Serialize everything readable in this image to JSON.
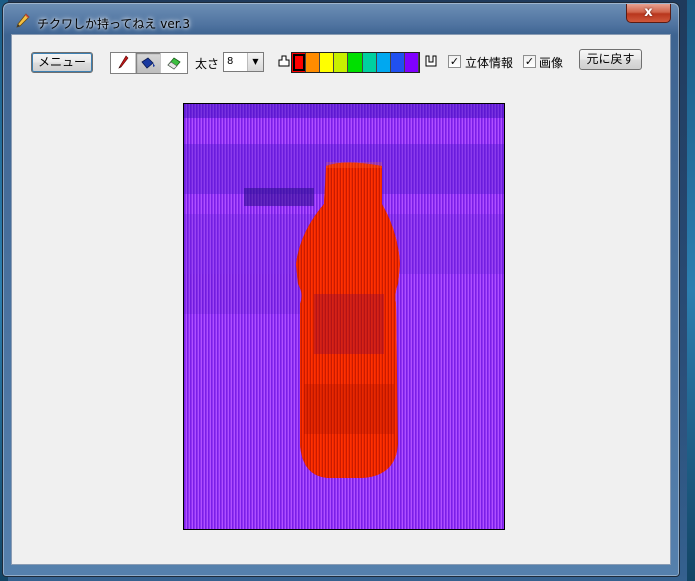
{
  "window": {
    "title": "チクワしか持ってねえ ver.3",
    "close_label": "x"
  },
  "toolbar": {
    "menu_label": "メニュー",
    "tools": [
      {
        "name": "pen",
        "icon": "pen-icon"
      },
      {
        "name": "fill",
        "icon": "paint-bucket-icon"
      },
      {
        "name": "eraser",
        "icon": "eraser-icon"
      }
    ],
    "active_tool": "fill",
    "size_label": "太さ",
    "size_value": "8",
    "convex_label": "凸",
    "concave_label": "凹",
    "palette": [
      "#ff0000",
      "#ff8c00",
      "#ffff00",
      "#c8f000",
      "#00e000",
      "#00d0a0",
      "#00a8f0",
      "#2050f0",
      "#8000ff"
    ],
    "selected_color_index": 0,
    "stereo_info_label": "立体情報",
    "stereo_info_checked": true,
    "image_label": "画像",
    "image_checked": true,
    "restore_label": "元に戻す"
  },
  "colors": {
    "background_stripe": "#7a1ee8",
    "background_stripe_alt": "#b050ff",
    "object_stripe": "#ff3000",
    "object_stripe_alt": "#c81a00"
  }
}
